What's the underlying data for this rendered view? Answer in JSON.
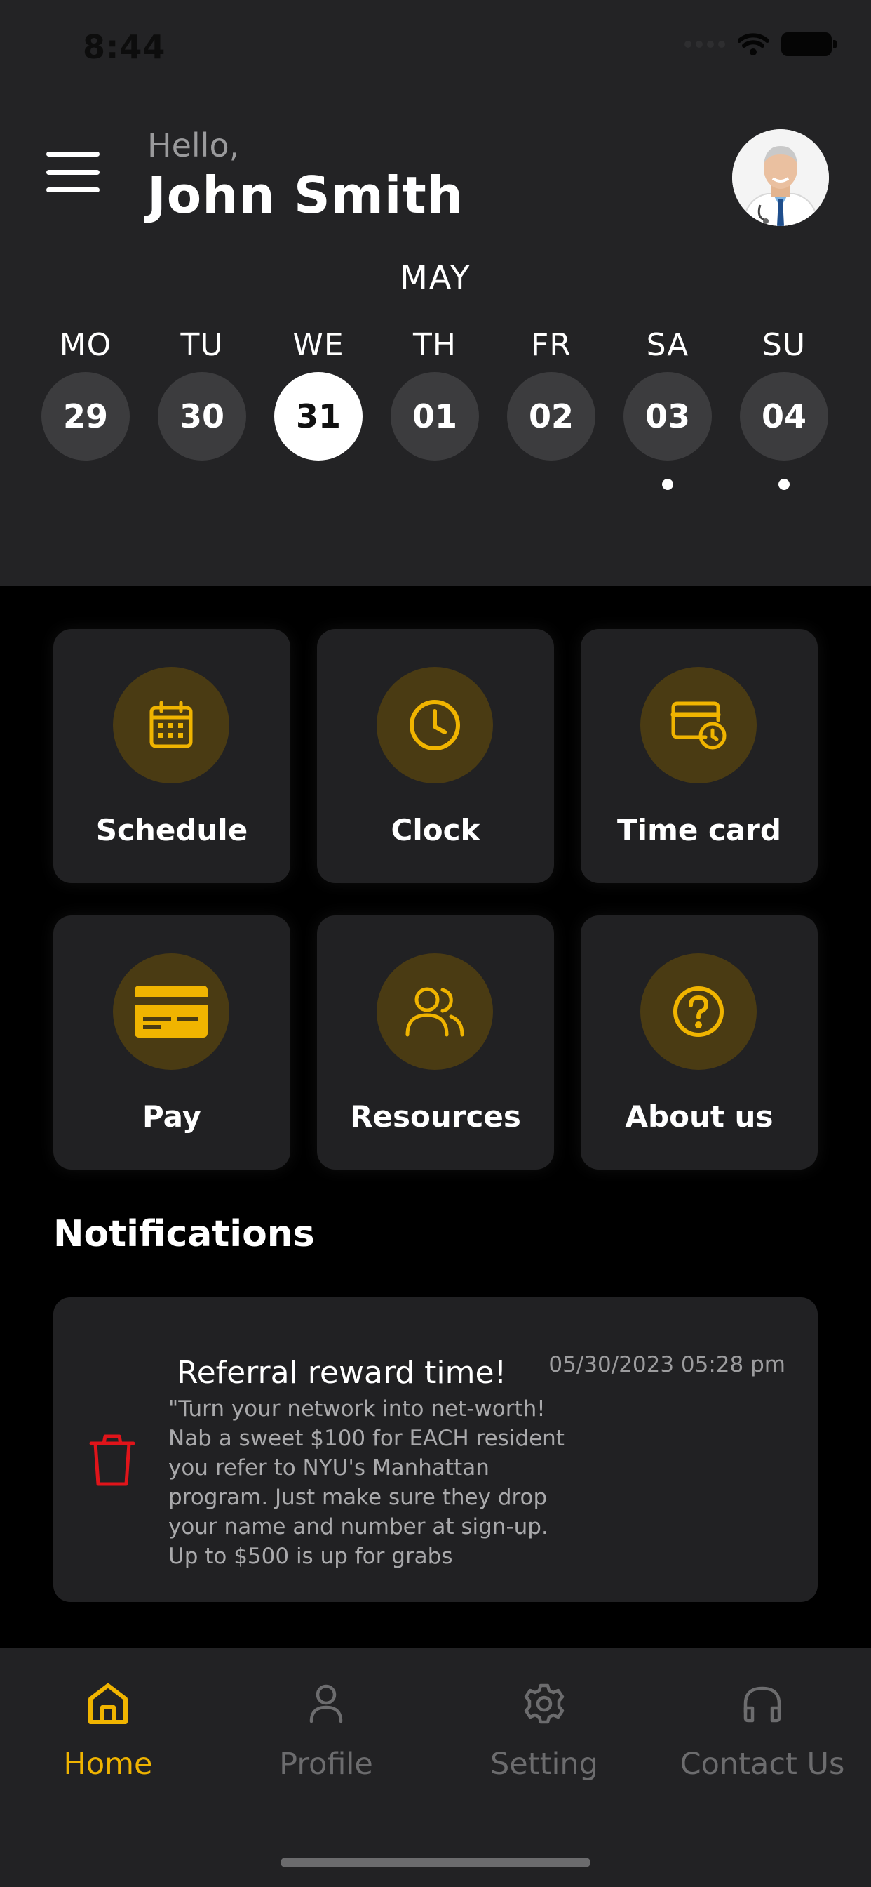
{
  "status_bar": {
    "time": "8:44"
  },
  "header": {
    "greeting": "Hello,",
    "name": "John Smith"
  },
  "calendar": {
    "month": "MAY",
    "days": [
      {
        "name": "MO",
        "num": "29",
        "active": false,
        "dot": false
      },
      {
        "name": "TU",
        "num": "30",
        "active": false,
        "dot": false
      },
      {
        "name": "WE",
        "num": "31",
        "active": true,
        "dot": false
      },
      {
        "name": "TH",
        "num": "01",
        "active": false,
        "dot": false
      },
      {
        "name": "FR",
        "num": "02",
        "active": false,
        "dot": false
      },
      {
        "name": "SA",
        "num": "03",
        "active": false,
        "dot": true
      },
      {
        "name": "SU",
        "num": "04",
        "active": false,
        "dot": true
      }
    ]
  },
  "tiles": [
    {
      "label": "Schedule",
      "icon": "calendar-icon"
    },
    {
      "label": "Clock",
      "icon": "clock-icon"
    },
    {
      "label": "Time card",
      "icon": "time-card-icon"
    },
    {
      "label": "Pay",
      "icon": "credit-card-icon"
    },
    {
      "label": "Resources",
      "icon": "users-icon"
    },
    {
      "label": "About us",
      "icon": "help-circle-icon"
    }
  ],
  "notifications": {
    "heading": "Notifications",
    "items": [
      {
        "title": "Referral reward time!",
        "date": "05/30/2023 05:28 pm",
        "body": "\"Turn your network into net-worth! Nab a sweet $100 for EACH resident you refer to NYU's Manhattan program. Just make sure they drop your name and number at sign-up. Up to $500 is up for grabs"
      }
    ]
  },
  "bottom_nav": {
    "items": [
      {
        "label": "Home",
        "icon": "home-icon",
        "active": true
      },
      {
        "label": "Profile",
        "icon": "user-icon",
        "active": false
      },
      {
        "label": "Setting",
        "icon": "gear-icon",
        "active": false
      },
      {
        "label": "Contact Us",
        "icon": "headphones-icon",
        "active": false
      }
    ]
  },
  "colors": {
    "accent": "#f0b400",
    "tile_icon_bg": "#4a3b13",
    "panel": "#232325",
    "trash": "#e0141a"
  }
}
